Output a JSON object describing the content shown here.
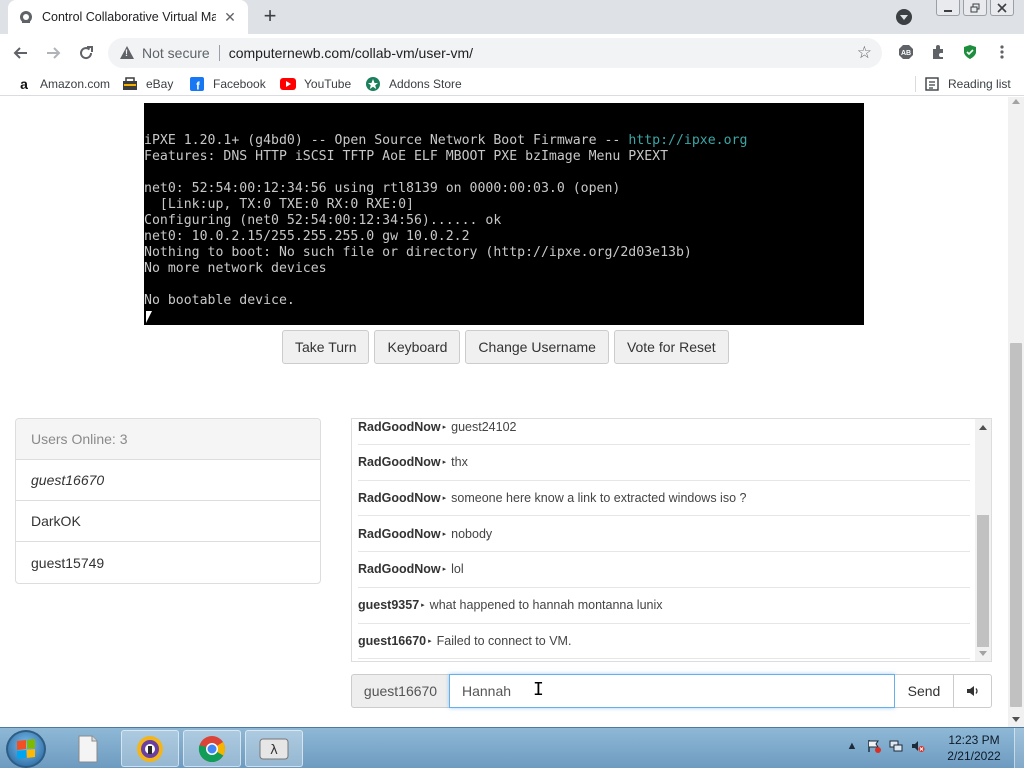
{
  "browser": {
    "tab_title": "Control Collaborative Virtual Ma",
    "tab_close": "✕",
    "new_tab": "+",
    "not_secure": "Not secure",
    "url": "computernewb.com/collab-vm/user-vm/",
    "bookmarks": [
      {
        "label": "Amazon.com",
        "icon": "amazon-icon"
      },
      {
        "label": "eBay",
        "icon": "ebay-icon"
      },
      {
        "label": "Facebook",
        "icon": "facebook-icon"
      },
      {
        "label": "YouTube",
        "icon": "youtube-icon"
      },
      {
        "label": "Addons Store",
        "icon": "addons-store-icon"
      }
    ],
    "reading_list": "Reading list"
  },
  "vm": {
    "lines": [
      {
        "text": "iPXE 1.20.1+ (g4bd0) -- Open Source Network Boot Firmware -- ",
        "link": "http://ipxe.org"
      },
      {
        "text": "Features: DNS HTTP iSCSI TFTP AoE ELF MBOOT PXE bzImage Menu PXEXT"
      },
      {
        "text": ""
      },
      {
        "text": "net0: 52:54:00:12:34:56 using rtl8139 on 0000:00:03.0 (open)"
      },
      {
        "text": "  [Link:up, TX:0 TXE:0 RX:0 RXE:0]"
      },
      {
        "text": "Configuring (net0 52:54:00:12:34:56)...... ok"
      },
      {
        "text": "net0: 10.0.2.15/255.255.255.0 gw 10.0.2.2"
      },
      {
        "text": "Nothing to boot: No such file or directory (http://ipxe.org/2d03e13b)"
      },
      {
        "text": "No more network devices"
      },
      {
        "text": ""
      },
      {
        "text": "No bootable device."
      }
    ]
  },
  "controls": {
    "take_turn": "Take Turn",
    "keyboard": "Keyboard",
    "change_username": "Change Username",
    "vote_reset": "Vote for Reset"
  },
  "users": {
    "header": "Users Online: 3",
    "list": [
      "guest16670",
      "DarkOK",
      "guest15749"
    ]
  },
  "chat": {
    "messages": [
      {
        "user": "RadGoodNow",
        "text": "guest24102"
      },
      {
        "user": "RadGoodNow",
        "text": "thx"
      },
      {
        "user": "RadGoodNow",
        "text": "someone here know a link to extracted windows iso ?"
      },
      {
        "user": "RadGoodNow",
        "text": "nobody"
      },
      {
        "user": "RadGoodNow",
        "text": "lol"
      },
      {
        "user": "guest9357",
        "text": "what happened to hannah montanna lunix"
      },
      {
        "user": "guest16670",
        "text": "Failed to connect to VM."
      }
    ],
    "arrow": "▸"
  },
  "chat_input": {
    "username": "guest16670",
    "value": "Hannah",
    "send": "Send",
    "ibeam": "I"
  },
  "taskbar": {
    "time": "12:23 PM",
    "date": "2/21/2022"
  }
}
